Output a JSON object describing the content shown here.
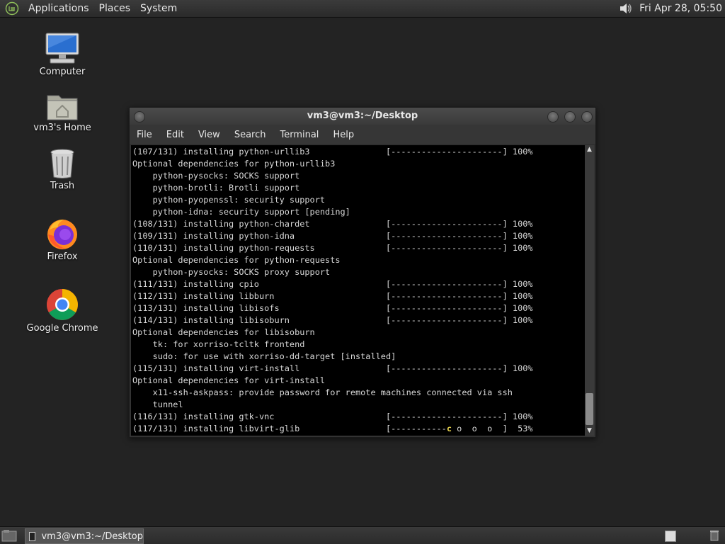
{
  "top_panel": {
    "menus": [
      "Applications",
      "Places",
      "System"
    ],
    "clock": "Fri Apr 28, 05:50"
  },
  "desktop_icons": [
    {
      "label": "Computer",
      "icon": "computer-icon"
    },
    {
      "label": "vm3's Home",
      "icon": "home-folder-icon"
    },
    {
      "label": "Trash",
      "icon": "trash-icon"
    },
    {
      "label": "Firefox",
      "icon": "firefox-icon"
    },
    {
      "label": "Google Chrome",
      "icon": "chrome-icon"
    }
  ],
  "terminal": {
    "title": "vm3@vm3:~/Desktop",
    "menu": [
      "File",
      "Edit",
      "View",
      "Search",
      "Terminal",
      "Help"
    ],
    "lines": [
      "(107/131) installing python-urllib3               [----------------------] 100%",
      "Optional dependencies for python-urllib3",
      "    python-pysocks: SOCKS support",
      "    python-brotli: Brotli support",
      "    python-pyopenssl: security support",
      "    python-idna: security support [pending]",
      "(108/131) installing python-chardet               [----------------------] 100%",
      "(109/131) installing python-idna                  [----------------------] 100%",
      "(110/131) installing python-requests              [----------------------] 100%",
      "Optional dependencies for python-requests",
      "    python-pysocks: SOCKS proxy support",
      "(111/131) installing cpio                         [----------------------] 100%",
      "(112/131) installing libburn                      [----------------------] 100%",
      "(113/131) installing libisofs                     [----------------------] 100%",
      "(114/131) installing libisoburn                   [----------------------] 100%",
      "Optional dependencies for libisoburn",
      "    tk: for xorriso-tcltk frontend",
      "    sudo: for use with xorriso-dd-target [installed]",
      "(115/131) installing virt-install                 [----------------------] 100%",
      "Optional dependencies for virt-install",
      "    x11-ssh-askpass: provide password for remote machines connected via ssh",
      "    tunnel",
      "(116/131) installing gtk-vnc                      [----------------------] 100%"
    ],
    "last_line": {
      "prefix": "(117/131) installing libvirt-glib                 [-----------",
      "pacman": "c",
      "suffix": " o  o  o  ]  53%"
    }
  },
  "taskbar": {
    "window_button": "vm3@vm3:~/Desktop"
  }
}
